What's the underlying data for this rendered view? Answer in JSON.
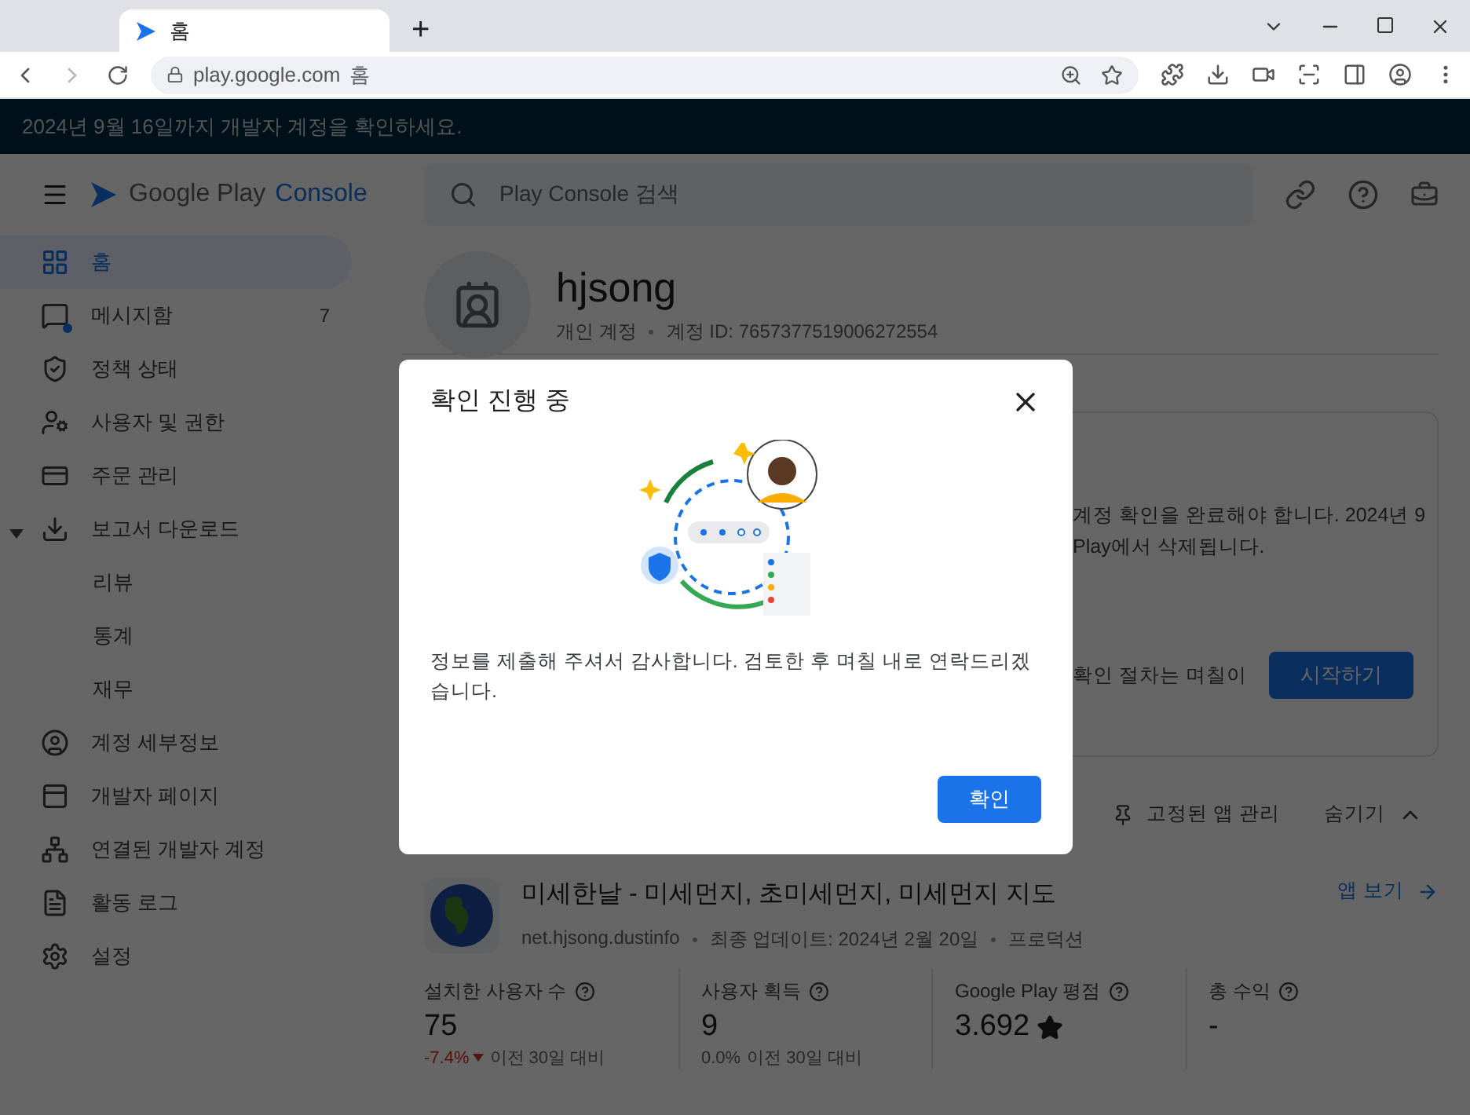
{
  "browser": {
    "tab": {
      "title": "홈",
      "selected": true
    },
    "new_tab": "+",
    "address": {
      "host": "play.google.com",
      "page": "홈"
    }
  },
  "banner": "2024년 9월 16일까지 개발자 계정을 확인하세요.",
  "header": {
    "logo": {
      "word_1": "Google Play",
      "word_2": "Console"
    },
    "search": {
      "placeholder": "Play Console 검색"
    }
  },
  "sidebar": {
    "items": [
      {
        "label": "홈",
        "selected": true
      },
      {
        "label": "메시지함",
        "badge": "7",
        "unread": true,
        "selected": false
      },
      {
        "label": "정책 상태",
        "selected": false
      },
      {
        "label": "사용자 및 권한",
        "selected": false
      },
      {
        "label": "주문 관리",
        "selected": false
      },
      {
        "label": "보고서 다운로드",
        "selected": false,
        "expanded": true,
        "children": [
          {
            "label": "리뷰",
            "selected": false
          },
          {
            "label": "통계",
            "selected": false
          },
          {
            "label": "재무",
            "selected": false
          }
        ]
      },
      {
        "label": "계정 세부정보",
        "selected": false
      },
      {
        "label": "개발자 페이지",
        "selected": false
      },
      {
        "label": "연결된 개발자 계정",
        "selected": false
      },
      {
        "label": "활동 로그",
        "selected": false
      },
      {
        "label": "설정",
        "selected": false
      }
    ]
  },
  "account": {
    "name": "hjsong",
    "type": "개인 계정",
    "id": "계정 ID: 7657377519006272554"
  },
  "notice": {
    "lines": [
      "계정 확인을 완료해야 합니다. 2024년 9",
      "Play에서 삭제됩니다."
    ],
    "note": "확인 절차는 며칠이",
    "button": "시작하기"
  },
  "app_list": {
    "manage_pinned": "고정된 앱 관리",
    "hide": "숨기기"
  },
  "app": {
    "title": "미세한날 - 미세먼지, 초미세먼지, 미세먼지 지도",
    "package": "net.hjsong.dustinfo",
    "updated": "최종 업데이트: 2024년 2월 20일",
    "status": "프로덕션",
    "view": "앱 보기",
    "stats": [
      {
        "label": "설치한 사용자 수",
        "value": "75",
        "change": "-7.4%",
        "kind": "down",
        "compare": "이전 30일 대비"
      },
      {
        "label": "사용자 획득",
        "value": "9",
        "change": "0.0%",
        "kind": "flat",
        "compare": "이전 30일 대비"
      },
      {
        "label": "Google Play 평점",
        "value": "3.692",
        "star": true
      },
      {
        "label": "총 수익",
        "value": "-"
      }
    ]
  },
  "dialog": {
    "title": "확인 진행 중",
    "message": "정보를 제출해 주셔서 감사합니다. 검토한 후 며칠 내로 연락드리겠습니다.",
    "button": "확인"
  }
}
